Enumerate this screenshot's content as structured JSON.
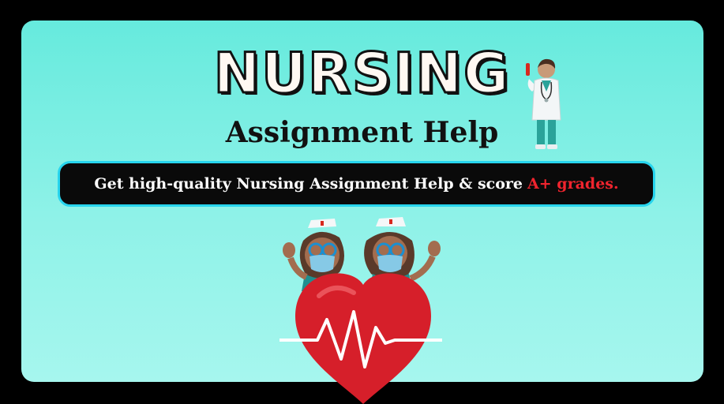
{
  "title": "NURSING",
  "subtitle": "Assignment Help",
  "banner": {
    "text": "Get high-quality Nursing Assignment Help & score",
    "highlight": "A+ grades."
  },
  "colors": {
    "background": "#66eadd",
    "banner_border": "#27d5ee",
    "highlight": "#f0242e",
    "heart": "#d61f2a"
  },
  "illustrations": [
    "doctor-figure",
    "nurse-figures",
    "heart-ecg-icon"
  ]
}
